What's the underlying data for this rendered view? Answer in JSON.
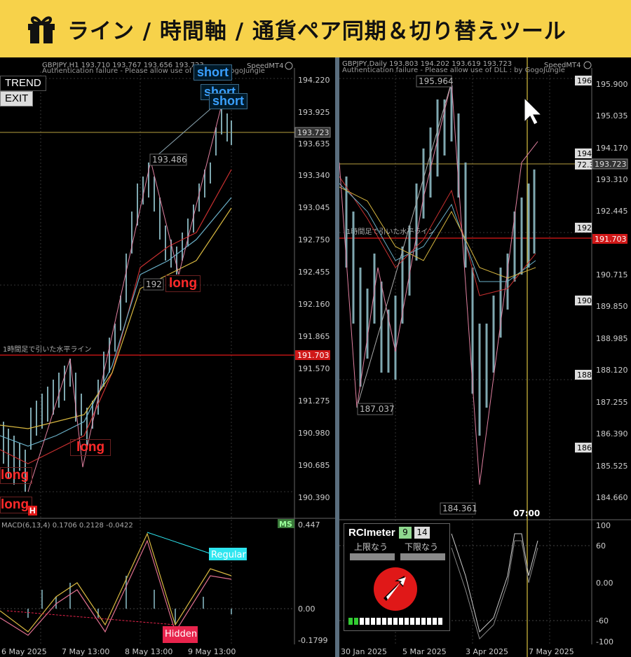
{
  "banner": {
    "title": "ライン / 時間軸 / 通貨ペア同期＆切り替えツール",
    "icon": "gift-icon"
  },
  "left": {
    "header_line1": "GBPJPY,H1  193.710 193.767 193.656 193.723",
    "header_line2": "Authentication failure - Please allow use of DLL : by GogoJungle",
    "speed": "SpeedMT4",
    "trend_btn": "TREND",
    "exit_btn": "EXIT",
    "price_ticks": [
      "194.220",
      "193.925",
      "193.635",
      "193.340",
      "193.045",
      "192.750",
      "192.455",
      "192.160",
      "191.865",
      "191.570",
      "191.275",
      "190.980",
      "190.685",
      "190.390"
    ],
    "current_price": "193.723",
    "line_price": "191.703",
    "hline_label": "1時間足で引いた水平ライン",
    "peak_label": "193.486",
    "low_label": "192",
    "short1": "short",
    "short2": "short",
    "short3": "short",
    "long1": "long",
    "long2": "long",
    "long3": "long",
    "long4": "long",
    "h_mark": "H",
    "macd_title": "MACD(6,13,4)  0.1706 0.2128 -0.0422",
    "ms": "MS",
    "macd_ticks": [
      "0.447",
      "0.00",
      "-0.1799"
    ],
    "regular": "Regular",
    "hidden": "Hidden",
    "dates": [
      "6 May 2025",
      "7 May 13:00",
      "8 May 13:00",
      "9 May 13:00"
    ]
  },
  "right": {
    "header_line1": "GBPJPY,Daily  193.803 194.202 193.619 193.723",
    "header_line2": "Authentication failure - Please allow use of DLL : by GogoJungle",
    "speed": "SpeedMT4",
    "price_ticks": [
      "195.900",
      "195.035",
      "194.170",
      "193.310",
      "192.445",
      "190.715",
      "189.850",
      "188.985",
      "188.120",
      "187.255",
      "186.390",
      "185.525",
      "184.660"
    ],
    "current_price": "193.723",
    "line_price": "191.703",
    "hline_label": "1時間足で引いた水平ライン",
    "box_labels": [
      "196",
      "194",
      "72.3",
      "192",
      "190",
      "188",
      "186"
    ],
    "top_label": "195.964",
    "low1": "187.037",
    "low2": "184.361",
    "time_label": "07:00",
    "rci_ticks": [
      "100",
      "60",
      "0.00",
      "-60",
      "-100"
    ],
    "dates": [
      "30 Jan 2025",
      "5 Mar 2025",
      "3 Apr 2025",
      "7 May 2025"
    ]
  },
  "rci": {
    "title": "RCImeter",
    "val1": "9",
    "val2": "14",
    "upper": "上限なう",
    "lower": "下限なう",
    "arrow": "up-right-arrow-icon"
  },
  "colors": {
    "banner": "#f7d24a",
    "long": "#ff2a2a",
    "short": "#3aa0ff",
    "regular": "#2ee6f0",
    "hidden": "#e8244c",
    "line": "#e01818"
  }
}
